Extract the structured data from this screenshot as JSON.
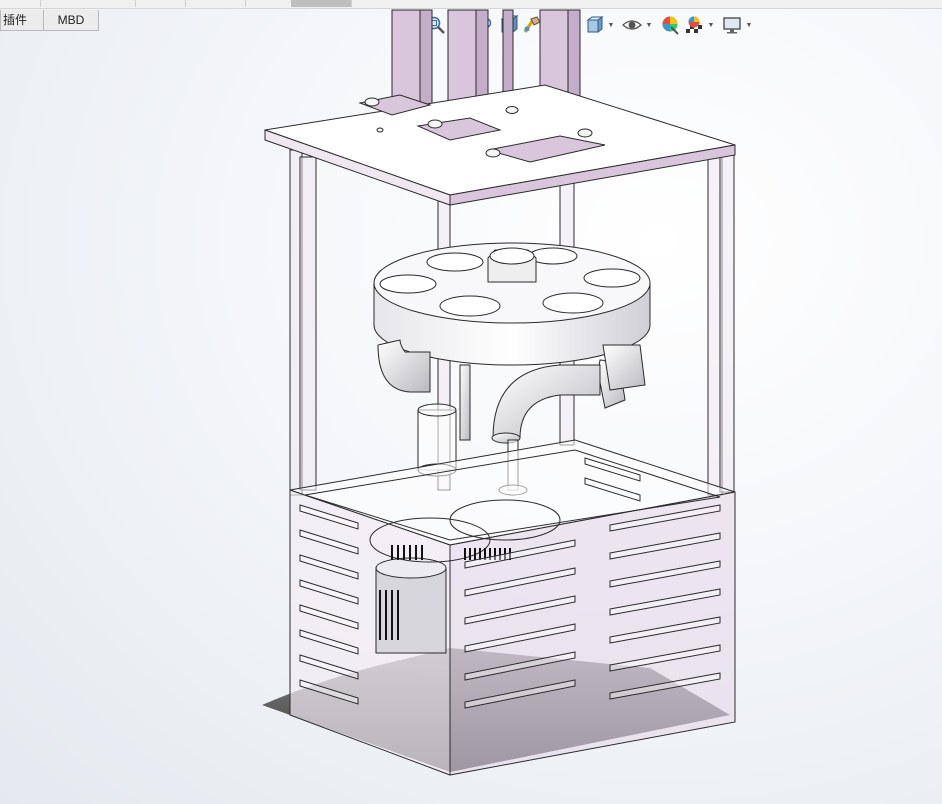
{
  "tabs": [
    {
      "label": "插件",
      "active": false
    },
    {
      "label": "MBD",
      "active": false
    }
  ],
  "hud_toolbar": [
    {
      "icon": "zoom-to-fit-icon",
      "caret": false
    },
    {
      "icon": "zoom-to-area-icon",
      "caret": false
    },
    {
      "icon": "previous-view-icon",
      "caret": false
    },
    {
      "icon": "section-view-icon",
      "caret": false
    },
    {
      "icon": "dynamic-annotation-icon",
      "caret": false
    },
    {
      "icon": "view-orientation-icon",
      "caret": true
    },
    {
      "icon": "display-style-icon",
      "caret": true
    },
    {
      "icon": "hide-show-items-icon",
      "caret": true
    },
    {
      "icon": "edit-appearance-icon",
      "caret": false
    },
    {
      "icon": "apply-scene-icon",
      "caret": true
    },
    {
      "icon": "view-settings-icon",
      "caret": true
    }
  ],
  "colors": {
    "frame_purple": "#d9c6dc",
    "edge": "#2b2b2b",
    "metal": "#f3f3f5",
    "shadow": "#2e2e2e"
  }
}
